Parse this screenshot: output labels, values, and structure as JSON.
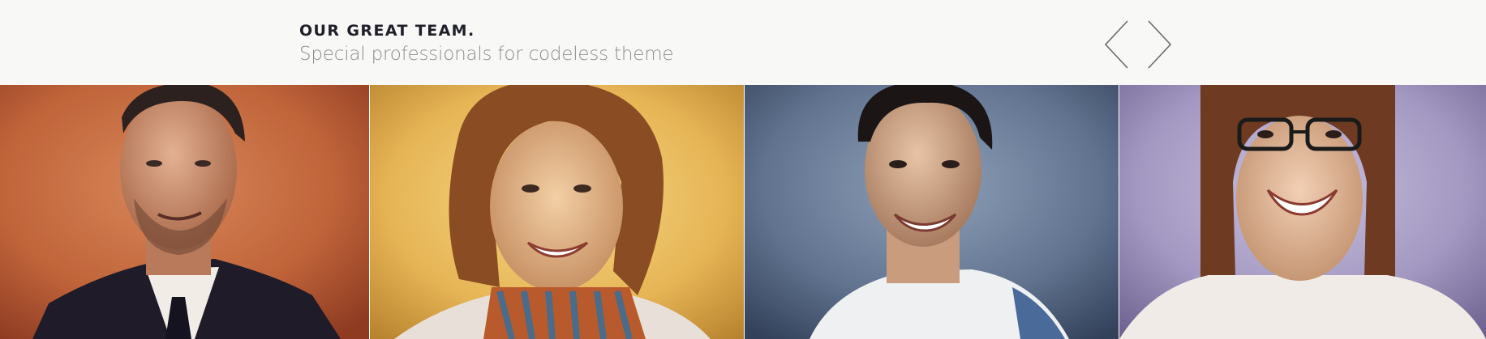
{
  "section": {
    "title": "OUR GREAT TEAM.",
    "subtitle": "Special professionals for codeless theme"
  },
  "navigation": {
    "prev_icon": "chevron-left-icon",
    "next_icon": "chevron-right-icon"
  },
  "team": [
    {
      "photo": "man-in-suit-portrait",
      "background_color": "#c56a3e"
    },
    {
      "photo": "woman-with-scarf-portrait",
      "background_color": "#e9b75a"
    },
    {
      "photo": "young-man-portrait",
      "background_color": "#5b6f8f"
    },
    {
      "photo": "woman-with-glasses-portrait",
      "background_color": "#a99dc4"
    }
  ]
}
